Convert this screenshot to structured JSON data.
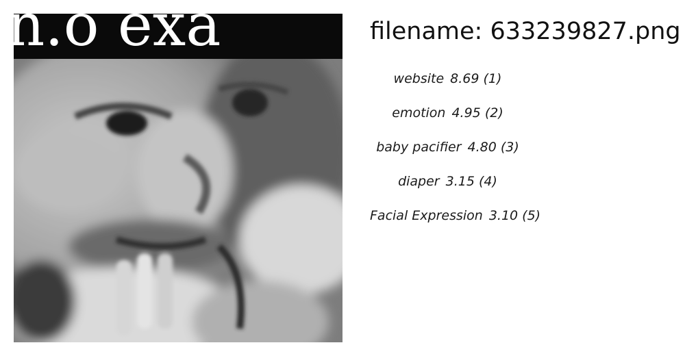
{
  "filename_text": "filename: 633239827.png",
  "photo": {
    "overlay_text": "n.o exa",
    "subject": "grayscale close-up of a young child's face with hand near mouth"
  },
  "labels": [
    {
      "name": "website",
      "score": "8.69",
      "rank": "(1)"
    },
    {
      "name": "emotion",
      "score": "4.95",
      "rank": "(2)"
    },
    {
      "name": "baby pacifier",
      "score": "4.80",
      "rank": "(3)"
    },
    {
      "name": "diaper",
      "score": "3.15",
      "rank": "(4)"
    },
    {
      "name": "Facial Expression",
      "score": "3.10",
      "rank": "(5)"
    }
  ]
}
